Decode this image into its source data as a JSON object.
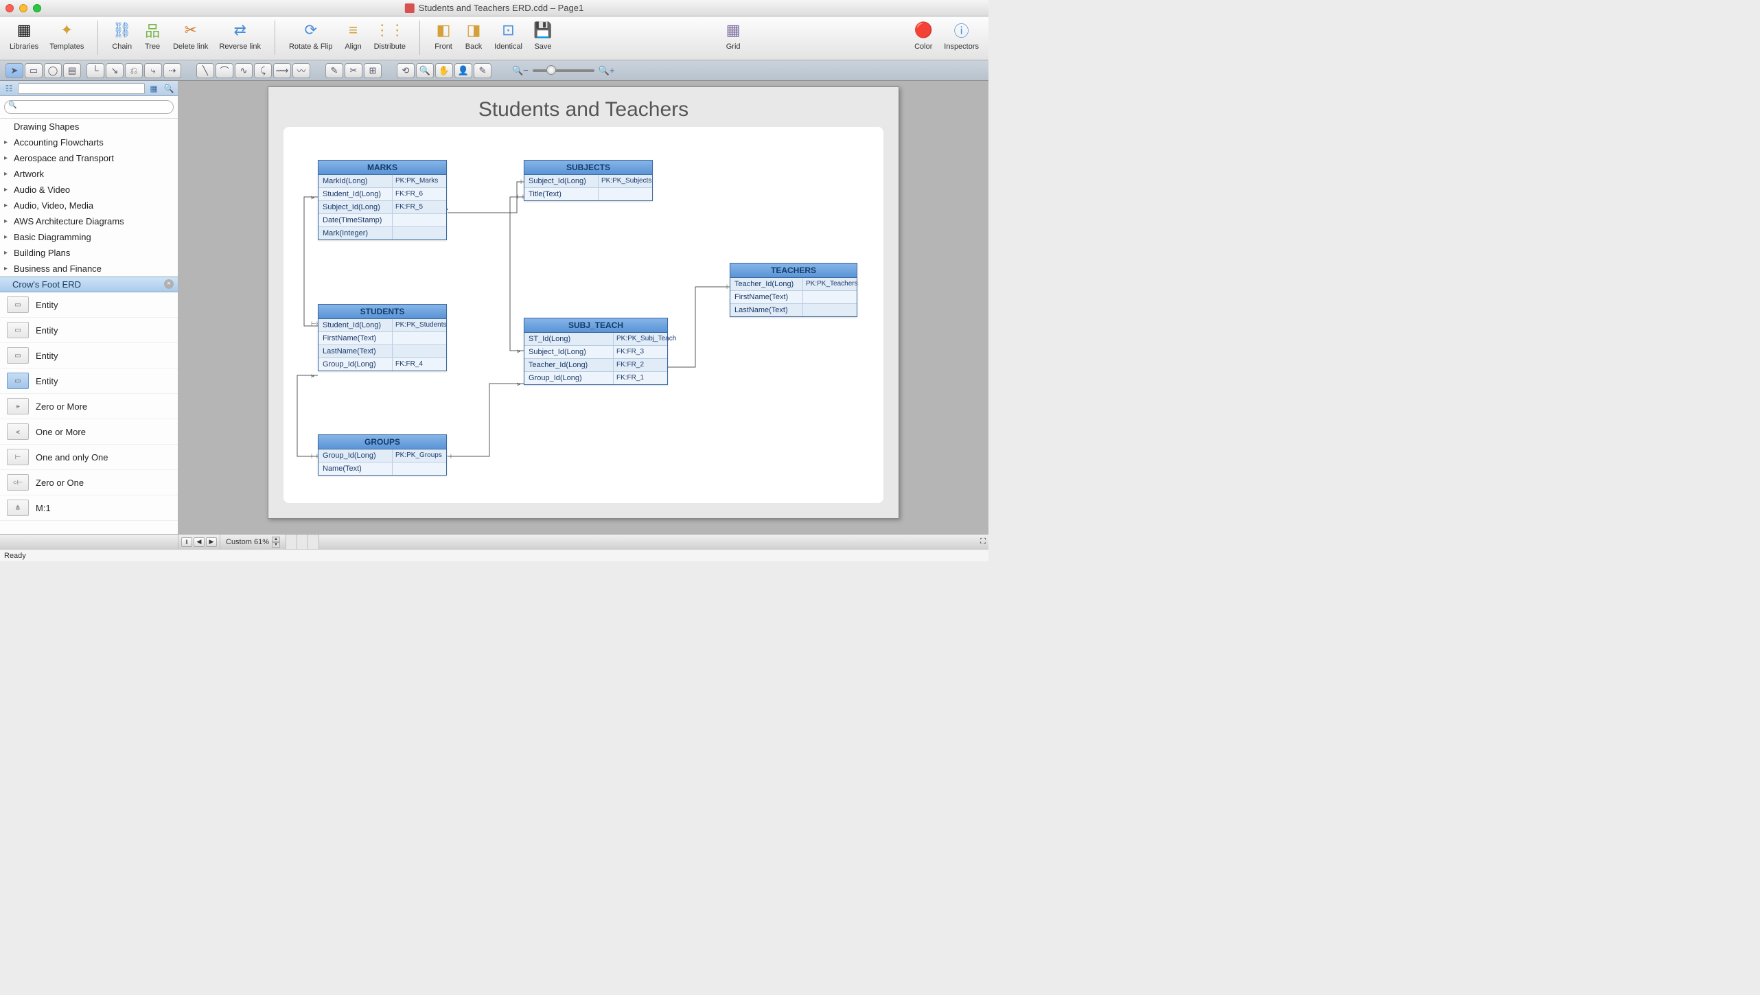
{
  "titlebar": {
    "title": "Students and Teachers ERD.cdd – Page1"
  },
  "toolbar": {
    "libraries": "Libraries",
    "templates": "Templates",
    "chain": "Chain",
    "tree": "Tree",
    "delete_link": "Delete link",
    "reverse_link": "Reverse link",
    "rotate_flip": "Rotate & Flip",
    "align": "Align",
    "distribute": "Distribute",
    "front": "Front",
    "back": "Back",
    "identical": "Identical",
    "save": "Save",
    "grid": "Grid",
    "color": "Color",
    "inspectors": "Inspectors"
  },
  "sidebar": {
    "categories": [
      "Drawing Shapes",
      "Accounting Flowcharts",
      "Aerospace and Transport",
      "Artwork",
      "Audio & Video",
      "Audio, Video, Media",
      "AWS Architecture Diagrams",
      "Basic Diagramming",
      "Building Plans",
      "Business and Finance"
    ],
    "selected": "Crow's Foot ERD",
    "shapes": [
      "Entity",
      "Entity",
      "Entity",
      "Entity",
      "Zero or More",
      "One or More",
      "One and only One",
      "Zero or One",
      "M:1"
    ]
  },
  "diagram": {
    "title": "Students and Teachers",
    "entities": {
      "marks": {
        "name": "MARKS",
        "rows": [
          {
            "col": "MarkId(Long)",
            "key": "PK:PK_Marks"
          },
          {
            "col": "Student_Id(Long)",
            "key": "FK:FR_6"
          },
          {
            "col": "Subject_Id(Long)",
            "key": "FK:FR_5"
          },
          {
            "col": "Date(TimeStamp)",
            "key": ""
          },
          {
            "col": "Mark(Integer)",
            "key": ""
          }
        ]
      },
      "subjects": {
        "name": "SUBJECTS",
        "rows": [
          {
            "col": "Subject_Id(Long)",
            "key": "PK:PK_Subjects"
          },
          {
            "col": "Title(Text)",
            "key": ""
          }
        ]
      },
      "students": {
        "name": "STUDENTS",
        "rows": [
          {
            "col": "Student_Id(Long)",
            "key": "PK:PK_Students"
          },
          {
            "col": "FirstName(Text)",
            "key": ""
          },
          {
            "col": "LastName(Text)",
            "key": ""
          },
          {
            "col": "Group_Id(Long)",
            "key": "FK:FR_4"
          }
        ]
      },
      "subj_teach": {
        "name": "SUBJ_TEACH",
        "rows": [
          {
            "col": "ST_Id(Long)",
            "key": "PK:PK_Subj_Teach"
          },
          {
            "col": "Subject_Id(Long)",
            "key": "FK:FR_3"
          },
          {
            "col": "Teacher_Id(Long)",
            "key": "FK:FR_2"
          },
          {
            "col": "Group_Id(Long)",
            "key": "FK:FR_1"
          }
        ]
      },
      "groups": {
        "name": "GROUPS",
        "rows": [
          {
            "col": "Group_Id(Long)",
            "key": "PK:PK_Groups"
          },
          {
            "col": "Name(Text)",
            "key": ""
          }
        ]
      },
      "teachers": {
        "name": "TEACHERS",
        "rows": [
          {
            "col": "Teacher_Id(Long)",
            "key": "PK:PK_Teachers"
          },
          {
            "col": "FirstName(Text)",
            "key": ""
          },
          {
            "col": "LastName(Text)",
            "key": ""
          }
        ]
      }
    }
  },
  "bottom": {
    "zoom": "Custom 61%"
  },
  "status": {
    "ready": "Ready"
  }
}
